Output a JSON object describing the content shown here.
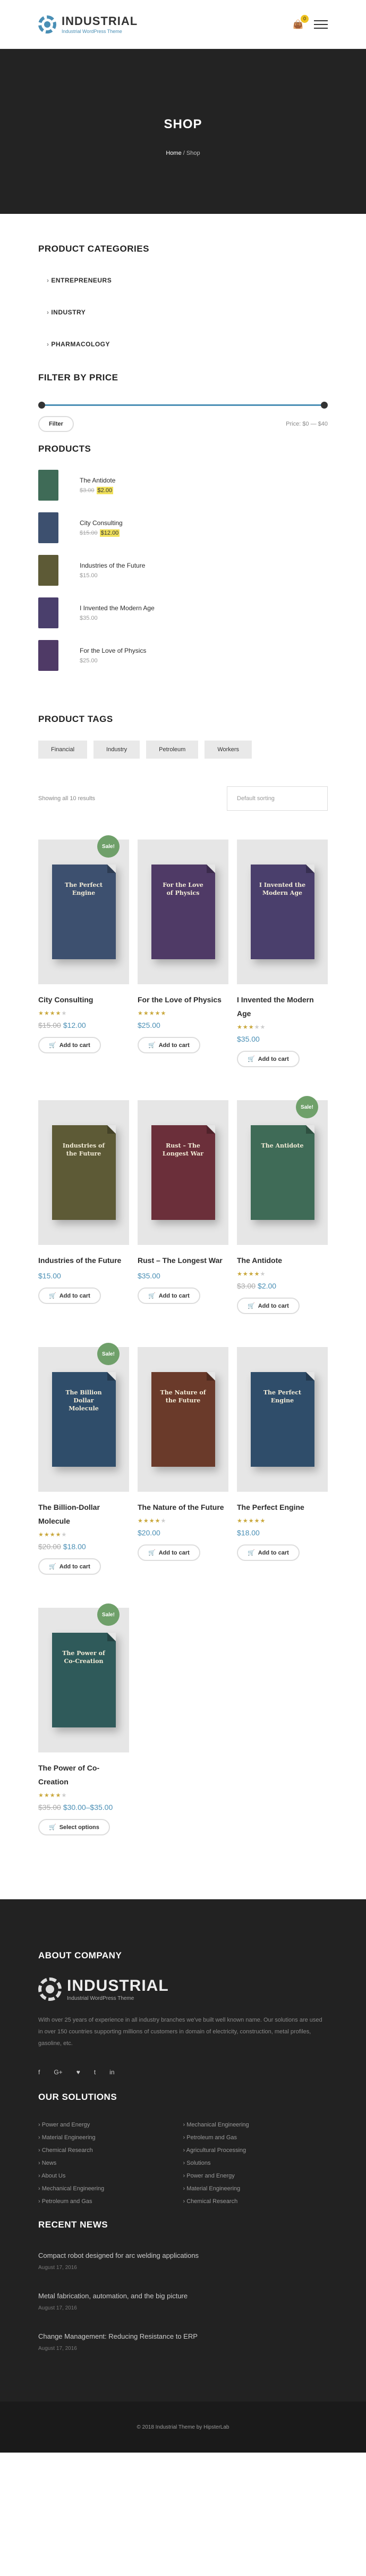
{
  "header": {
    "logo_name": "INDUSTRIAL",
    "logo_tagline": "Industrial WordPress Theme",
    "cart_icon": "shopping-bag-icon",
    "cart_count": "0",
    "menu_icon": "hamburger-icon"
  },
  "hero": {
    "title": "SHOP",
    "breadcrumb_home": "Home",
    "breadcrumb_sep": "/",
    "breadcrumb_current": "Shop"
  },
  "categories": {
    "title": "PRODUCT CATEGORIES",
    "items": [
      "ENTREPRENEURS",
      "INDUSTRY",
      "PHARMACOLOGY"
    ]
  },
  "filter": {
    "title": "FILTER BY PRICE",
    "button": "Filter",
    "price_label": "Price: $0 — $40"
  },
  "products_widget": {
    "title": "PRODUCTS",
    "items": [
      {
        "name": "The Antidote",
        "old": "$3.00",
        "price": "$2.00",
        "color": "#3f6b57"
      },
      {
        "name": "City Consulting",
        "old": "$15.00",
        "price": "$12.00",
        "color": "#3d506f"
      },
      {
        "name": "Industries of the Future",
        "price": "$15.00",
        "color": "#5d5a36"
      },
      {
        "name": "I Invented the Modern Age",
        "price": "$35.00",
        "color": "#4a3f6c"
      },
      {
        "name": "For the Love of Physics",
        "price": "$25.00",
        "color": "#4f3a66"
      }
    ]
  },
  "tags": {
    "title": "PRODUCT TAGS",
    "items": [
      "Financial",
      "Industry",
      "Petroleum",
      "Workers"
    ]
  },
  "shop": {
    "showing": "Showing all 10 results",
    "sort_default": "Default sorting",
    "products": [
      {
        "name": "City Consulting",
        "cover": "The Perfect Engine",
        "color": "#3d506f",
        "sale": "Sale!",
        "rating": 4,
        "old": "$15.00",
        "price": "$12.00",
        "button": "Add to cart"
      },
      {
        "name": "For the Love of Physics",
        "cover": "For the Love of Physics",
        "color": "#4f3a66",
        "rating": 5,
        "price": "$25.00",
        "button": "Add to cart"
      },
      {
        "name": "I Invented the Modern Age",
        "cover": "I Invented the Modern Age",
        "color": "#4a3f6c",
        "rating": 3,
        "price": "$35.00",
        "button": "Add to cart"
      },
      {
        "name": "Industries of the Future",
        "cover": "Industries of the Future",
        "color": "#5d5a36",
        "price": "$15.00",
        "button": "Add to cart"
      },
      {
        "name": "Rust – The Longest War",
        "cover": "Rust – The Longest War",
        "color": "#6b2f3a",
        "price": "$35.00",
        "button": "Add to cart"
      },
      {
        "name": "The Antidote",
        "cover": "The Antidote",
        "color": "#3f6b57",
        "sale": "Sale!",
        "rating": 4,
        "old": "$3.00",
        "price": "$2.00",
        "button": "Add to cart"
      },
      {
        "name": "The Billion-Dollar Molecule",
        "cover": "The Billion Dollar Molecule",
        "color": "#2f4d6a",
        "sale": "Sale!",
        "rating": 4,
        "old": "$20.00",
        "price": "$18.00",
        "button": "Add to cart"
      },
      {
        "name": "The Nature of the Future",
        "cover": "The Nature of the Future",
        "color": "#6a3a2a",
        "rating": 4,
        "price": "$20.00",
        "button": "Add to cart"
      },
      {
        "name": "The Perfect Engine",
        "cover": "The Perfect Engine",
        "color": "#2f4d6a",
        "rating": 5,
        "price": "$18.00",
        "button": "Add to cart"
      },
      {
        "name": "The Power of Co-Creation",
        "cover": "The Power of Co-Creation",
        "color": "#2f5a5a",
        "sale": "Sale!",
        "rating": 4,
        "old": "$35.00",
        "price": "$30.00–$35.00",
        "button": "Select options"
      }
    ]
  },
  "footer": {
    "about_title": "ABOUT COMPANY",
    "logo_name": "INDUSTRIAL",
    "logo_tagline": "Industrial WordPress Theme",
    "about_text": "With over 25 years of experience in all industry branches we've built well known name. Our solutions are used in over 150 countries supporting millions of customers in domain of electricity, construction, metal profiles, gasoline, etc.",
    "social": [
      "f",
      "G+",
      "♥",
      "t",
      "in"
    ],
    "solutions_title": "OUR SOLUTIONS",
    "solutions": [
      "Power and Energy",
      "Mechanical Engineering",
      "Material Engineering",
      "Petroleum and Gas",
      "Chemical Research",
      "Agricultural Processing",
      "News",
      "Solutions",
      "About Us",
      "Power and Energy",
      "Mechanical Engineering",
      "Material Engineering",
      "Petroleum and Gas",
      "Chemical Research"
    ],
    "news_title": "RECENT NEWS",
    "news": [
      {
        "title": "Compact robot designed for arc welding applications",
        "date": "August 17, 2016"
      },
      {
        "title": "Metal fabrication, automation, and the big picture",
        "date": "August 17, 2016"
      },
      {
        "title": "Change Management: Reducing Resistance to ERP",
        "date": "August 17, 2016"
      }
    ],
    "copyright": "© 2018 Industrial Theme by HipsterLab"
  }
}
